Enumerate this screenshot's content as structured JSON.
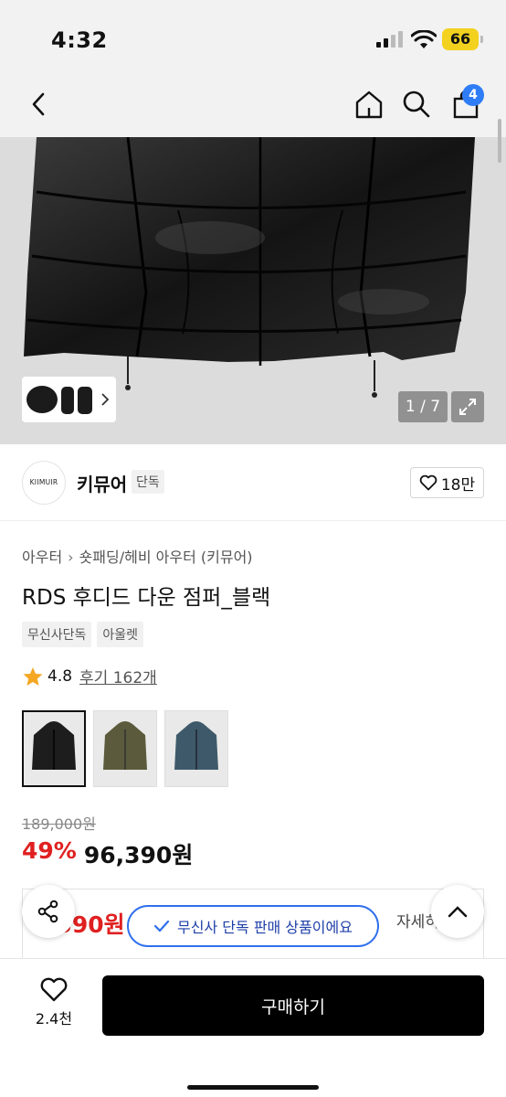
{
  "status_bar": {
    "time": "4:32",
    "battery": "66"
  },
  "nav": {
    "cart_count": "4"
  },
  "gallery": {
    "counter": "1 / 7"
  },
  "brand": {
    "logo_text": "KIIMUIR",
    "name": "키뮤어",
    "tag": "단독",
    "likes": "18만"
  },
  "breadcrumb": [
    "아우터",
    "숏패딩/헤비 아우터 (키뮤어)"
  ],
  "product": {
    "title": "RDS 후디드 다운 점퍼_블랙",
    "tags": [
      "무신사단독",
      "아울렛"
    ],
    "rating": "4.8",
    "review_link": "후기 162개",
    "original_price": "189,000원",
    "discount": "49%",
    "price": "96,390원"
  },
  "color_options": [
    {
      "name": "black",
      "color": "#1d1d1d",
      "selected": true
    },
    {
      "name": "khaki",
      "color": "#5b5a3c",
      "selected": false
    },
    {
      "name": "blue",
      "color": "#3e5a6a",
      "selected": false
    }
  ],
  "coupon": {
    "price_partial": ",390원",
    "detail_link": "자세히"
  },
  "toast": {
    "text": "무신사 단독 판매 상품이에요"
  },
  "bottom_bar": {
    "wish_count": "2.4천",
    "buy_label": "구매하기"
  },
  "colors": {
    "accent_blue": "#2f7df6",
    "sale_red": "#e02020",
    "buy_button": "#000000"
  }
}
